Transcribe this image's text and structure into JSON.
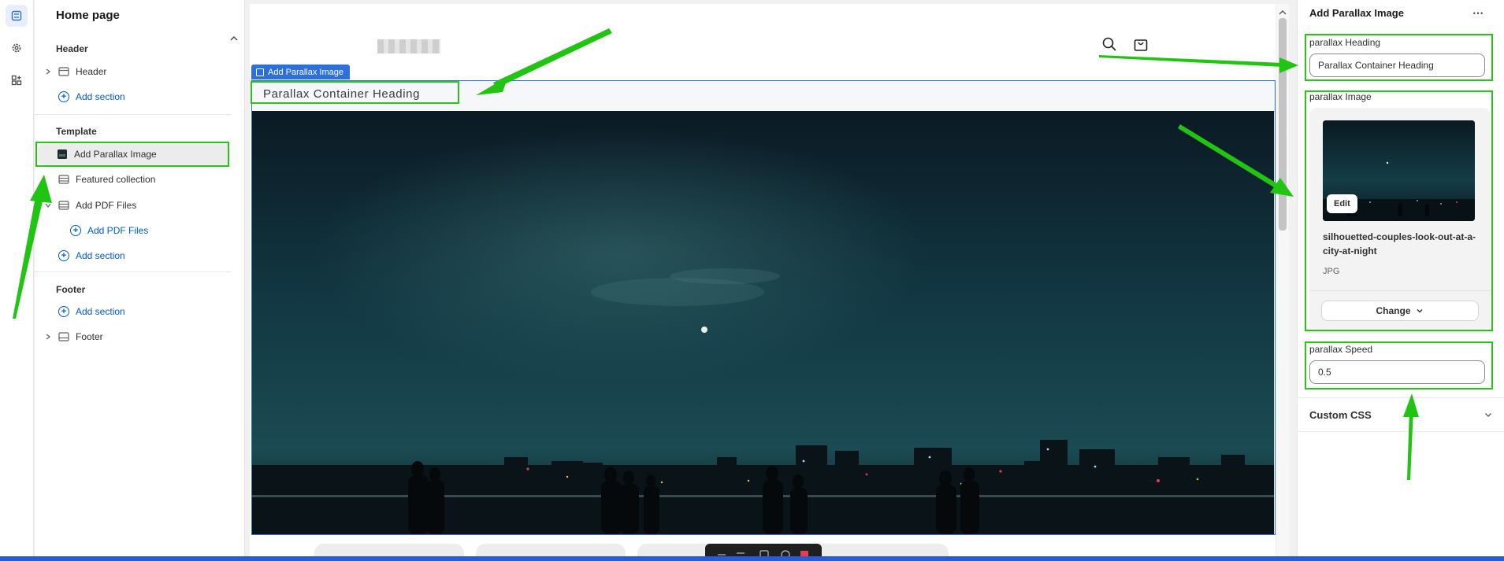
{
  "left_panel": {
    "title": "Home page",
    "groups": {
      "header": {
        "label": "Header",
        "item": "Header",
        "add": "Add section"
      },
      "template": {
        "label": "Template",
        "items": [
          "Add Parallax Image",
          "Featured collection",
          "Add PDF Files"
        ],
        "nested_add": "Add PDF Files",
        "add": "Add section"
      },
      "footer": {
        "label": "Footer",
        "add": "Add section",
        "item": "Footer"
      }
    }
  },
  "preview": {
    "section_tag": "Add Parallax Image",
    "heading": "Parallax Container Heading"
  },
  "right_panel": {
    "title": "Add Parallax Image",
    "more": "⋯",
    "heading_label": "parallax Heading",
    "heading_value": "Parallax Container Heading",
    "image_label": "parallax Image",
    "edit": "Edit",
    "file_name": "silhouetted-couples-look-out-at-a-city-at-night",
    "file_type": "JPG",
    "change": "Change",
    "speed_label": "parallax Speed",
    "speed_value": "0.5",
    "custom_css": "Custom CSS"
  },
  "colors": {
    "accent": "#005bd3",
    "highlight": "#28c417",
    "section_outline": "#2d6fdb"
  }
}
